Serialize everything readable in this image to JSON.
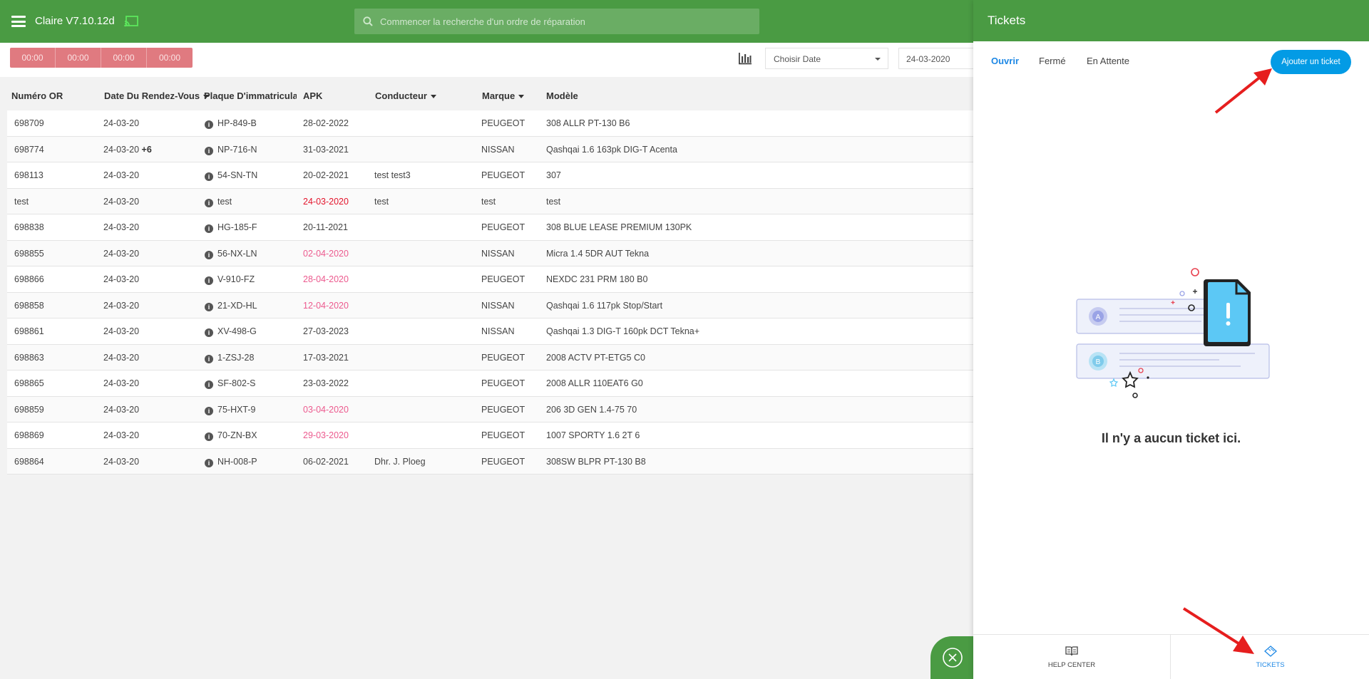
{
  "app": {
    "title": "Claire V7.10.12d",
    "search_placeholder": "Commencer la recherche d'un ordre de réparation"
  },
  "toolbar": {
    "timers": [
      "00:00",
      "00:00",
      "00:00",
      "00:00"
    ],
    "date_select": "Choisir Date",
    "date_value": "24-03-2020"
  },
  "table": {
    "columns": [
      "Numéro OR",
      "Date Du Rendez-Vous",
      "Plaque D'immatriculation",
      "APK",
      "Conducteur",
      "Marque",
      "Modèle"
    ],
    "rows": [
      {
        "or": "698709",
        "date": "24-03-20",
        "extra": "",
        "plate": "HP-849-B",
        "apk": "28-02-2022",
        "apk_status": "normal",
        "driver": "",
        "brand": "PEUGEOT",
        "model": "308 ALLR PT-130 B6"
      },
      {
        "or": "698774",
        "date": "24-03-20",
        "extra": "+6",
        "plate": "NP-716-N",
        "apk": "31-03-2021",
        "apk_status": "normal",
        "driver": "",
        "brand": "NISSAN",
        "model": "Qashqai 1.6 163pk DIG-T Acenta"
      },
      {
        "or": "698113",
        "date": "24-03-20",
        "extra": "",
        "plate": "54-SN-TN",
        "apk": "20-02-2021",
        "apk_status": "normal",
        "driver": "test test3",
        "brand": "PEUGEOT",
        "model": "307"
      },
      {
        "or": "test",
        "date": "24-03-20",
        "extra": "",
        "plate": "test",
        "apk": "24-03-2020",
        "apk_status": "red",
        "driver": "test",
        "brand": "test",
        "model": "test"
      },
      {
        "or": "698838",
        "date": "24-03-20",
        "extra": "",
        "plate": "HG-185-F",
        "apk": "20-11-2021",
        "apk_status": "normal",
        "driver": "",
        "brand": "PEUGEOT",
        "model": "308 BLUE LEASE PREMIUM 130PK"
      },
      {
        "or": "698855",
        "date": "24-03-20",
        "extra": "",
        "plate": "56-NX-LN",
        "apk": "02-04-2020",
        "apk_status": "pink",
        "driver": "",
        "brand": "NISSAN",
        "model": "Micra 1.4 5DR AUT Tekna"
      },
      {
        "or": "698866",
        "date": "24-03-20",
        "extra": "",
        "plate": "V-910-FZ",
        "apk": "28-04-2020",
        "apk_status": "pink",
        "driver": "",
        "brand": "PEUGEOT",
        "model": "NEXDC 231 PRM 180 B0"
      },
      {
        "or": "698858",
        "date": "24-03-20",
        "extra": "",
        "plate": "21-XD-HL",
        "apk": "12-04-2020",
        "apk_status": "pink",
        "driver": "",
        "brand": "NISSAN",
        "model": "Qashqai 1.6 117pk Stop/Start"
      },
      {
        "or": "698861",
        "date": "24-03-20",
        "extra": "",
        "plate": "XV-498-G",
        "apk": "27-03-2023",
        "apk_status": "normal",
        "driver": "",
        "brand": "NISSAN",
        "model": "Qashqai 1.3 DIG-T 160pk DCT Tekna+"
      },
      {
        "or": "698863",
        "date": "24-03-20",
        "extra": "",
        "plate": "1-ZSJ-28",
        "apk": "17-03-2021",
        "apk_status": "normal",
        "driver": "",
        "brand": "PEUGEOT",
        "model": "2008 ACTV PT-ETG5 C0"
      },
      {
        "or": "698865",
        "date": "24-03-20",
        "extra": "",
        "plate": "SF-802-S",
        "apk": "23-03-2022",
        "apk_status": "normal",
        "driver": "",
        "brand": "PEUGEOT",
        "model": "2008 ALLR 110EAT6 G0"
      },
      {
        "or": "698859",
        "date": "24-03-20",
        "extra": "",
        "plate": "75-HXT-9",
        "apk": "03-04-2020",
        "apk_status": "pink",
        "driver": "",
        "brand": "PEUGEOT",
        "model": "206 3D GEN 1.4-75 70"
      },
      {
        "or": "698869",
        "date": "24-03-20",
        "extra": "",
        "plate": "70-ZN-BX",
        "apk": "29-03-2020",
        "apk_status": "pink",
        "driver": "",
        "brand": "PEUGEOT",
        "model": "1007 SPORTY 1.6 2T 6"
      },
      {
        "or": "698864",
        "date": "24-03-20",
        "extra": "",
        "plate": "NH-008-P",
        "apk": "06-02-2021",
        "apk_status": "normal",
        "driver": "Dhr. J. Ploeg",
        "brand": "PEUGEOT",
        "model": "308SW BLPR PT-130 B8"
      }
    ]
  },
  "panel": {
    "title": "Tickets",
    "tabs": [
      "Ouvrir",
      "Fermé",
      "En Attente"
    ],
    "active_tab": "Ouvrir",
    "add_button": "Ajouter un ticket",
    "empty_text": "Il n'y a aucun ticket ici.",
    "illustration_letters": [
      "A",
      "B"
    ],
    "footer": {
      "help_label": "HELP CENTER",
      "tickets_label": "TICKETS"
    }
  },
  "colors": {
    "brand_green": "#4a9b43",
    "accent_blue": "#039be5",
    "apk_expired": "#e3142b",
    "apk_soon": "#ec5a8e",
    "annotation_arrow": "#e61e1e"
  }
}
